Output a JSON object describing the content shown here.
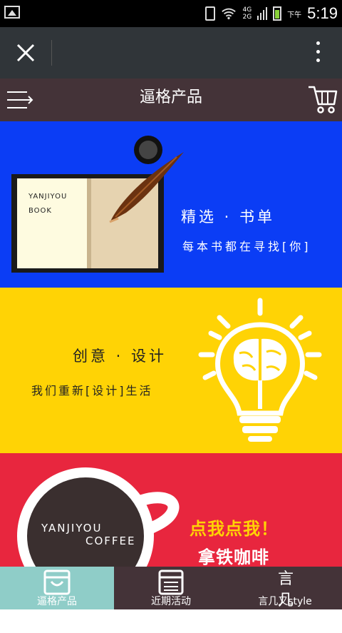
{
  "status_bar": {
    "time": "5:19",
    "ampm": "下午",
    "network_top": "4G",
    "network_bottom": "2G"
  },
  "header": {
    "title": "逼格产品"
  },
  "banners": [
    {
      "book_line1": "YANJIYOU",
      "book_line2": "BOOK",
      "title": "精选 · 书单",
      "subtitle": "每本书都在寻找[你]"
    },
    {
      "title": "创意 · 设计",
      "subtitle": "我们重新[设计]生活"
    },
    {
      "cup_line1": "YANJIYOU",
      "cup_line2": "COFFEE",
      "title": "点我点我！",
      "subtitle": "拿铁咖啡"
    }
  ],
  "tabs": [
    {
      "label": "逼格产品",
      "icon": "bag-icon",
      "active": true
    },
    {
      "label": "近期活动",
      "icon": "calendar-icon",
      "active": false
    },
    {
      "label": "言几又style",
      "icon": "brand-logo-icon",
      "active": false
    }
  ],
  "logo_text": "言几又",
  "colors": {
    "blue": "#0b3df5",
    "yellow": "#ffd305",
    "red": "#e8263e",
    "header": "#443338",
    "active_tab": "#8fcdc8"
  }
}
